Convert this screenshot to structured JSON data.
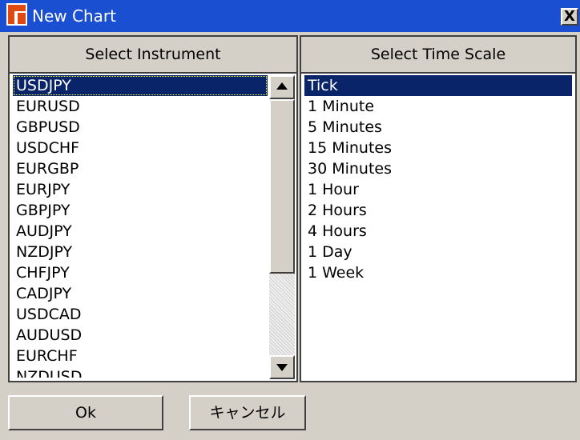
{
  "window": {
    "title": "New Chart",
    "close_label": "X"
  },
  "instrument_panel": {
    "header": "Select Instrument",
    "items": [
      "USDJPY",
      "EURUSD",
      "GBPUSD",
      "USDCHF",
      "EURGBP",
      "EURJPY",
      "GBPJPY",
      "AUDJPY",
      "NZDJPY",
      "CHFJPY",
      "CADJPY",
      "USDCAD",
      "AUDUSD",
      "EURCHF",
      "NZDUSD"
    ],
    "selected": "USDJPY"
  },
  "timescale_panel": {
    "header": "Select Time Scale",
    "items": [
      "Tick",
      "1 Minute",
      "5 Minutes",
      "15 Minutes",
      "30 Minutes",
      "1 Hour",
      "2 Hours",
      "4 Hours",
      "1 Day",
      "1 Week"
    ],
    "selected": "Tick"
  },
  "buttons": {
    "ok": "Ok",
    "cancel": "キャンセル"
  },
  "colors": {
    "titlebar": "#1a4fd2",
    "selection": "#0a246a",
    "dialog_bg": "#d4d0c8"
  }
}
